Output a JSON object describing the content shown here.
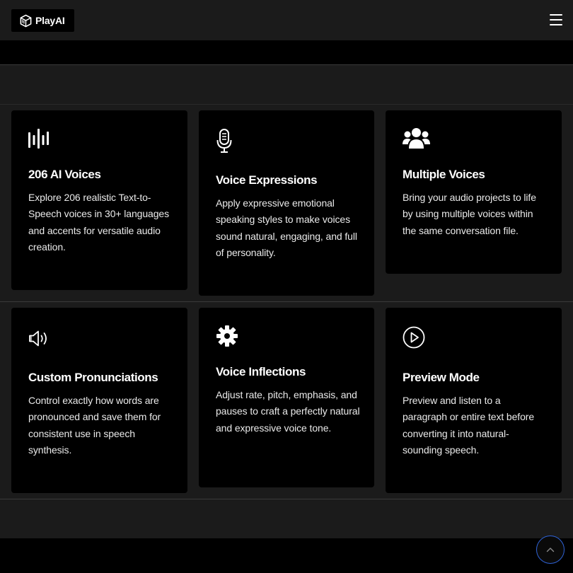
{
  "header": {
    "brand": "PlayAI"
  },
  "features": [
    {
      "title": "206 AI Voices",
      "description": "Explore 206 realistic Text-to-Speech voices in 30+ languages and accents for versatile audio creation."
    },
    {
      "title": "Voice Expressions",
      "description": "Apply expressive emotional speaking styles to make voices sound natural, engaging, and full of personality."
    },
    {
      "title": "Multiple Voices",
      "description": "Bring your audio projects to life by using multiple voices within the same conversation file."
    },
    {
      "title": "Custom Pronunciations",
      "description": "Control exactly how words are pronounced and save them for consistent use in speech synthesis."
    },
    {
      "title": "Voice Inflections",
      "description": "Adjust rate, pitch, emphasis, and pauses to craft a perfectly natural and expressive voice tone."
    },
    {
      "title": "Preview Mode",
      "description": "Preview and listen to a paragraph or entire text before converting it into natural-sounding speech."
    }
  ],
  "colors": {
    "page_background": "#1b1b1b",
    "card_background": "#000000",
    "accent": "#2f63d8"
  }
}
